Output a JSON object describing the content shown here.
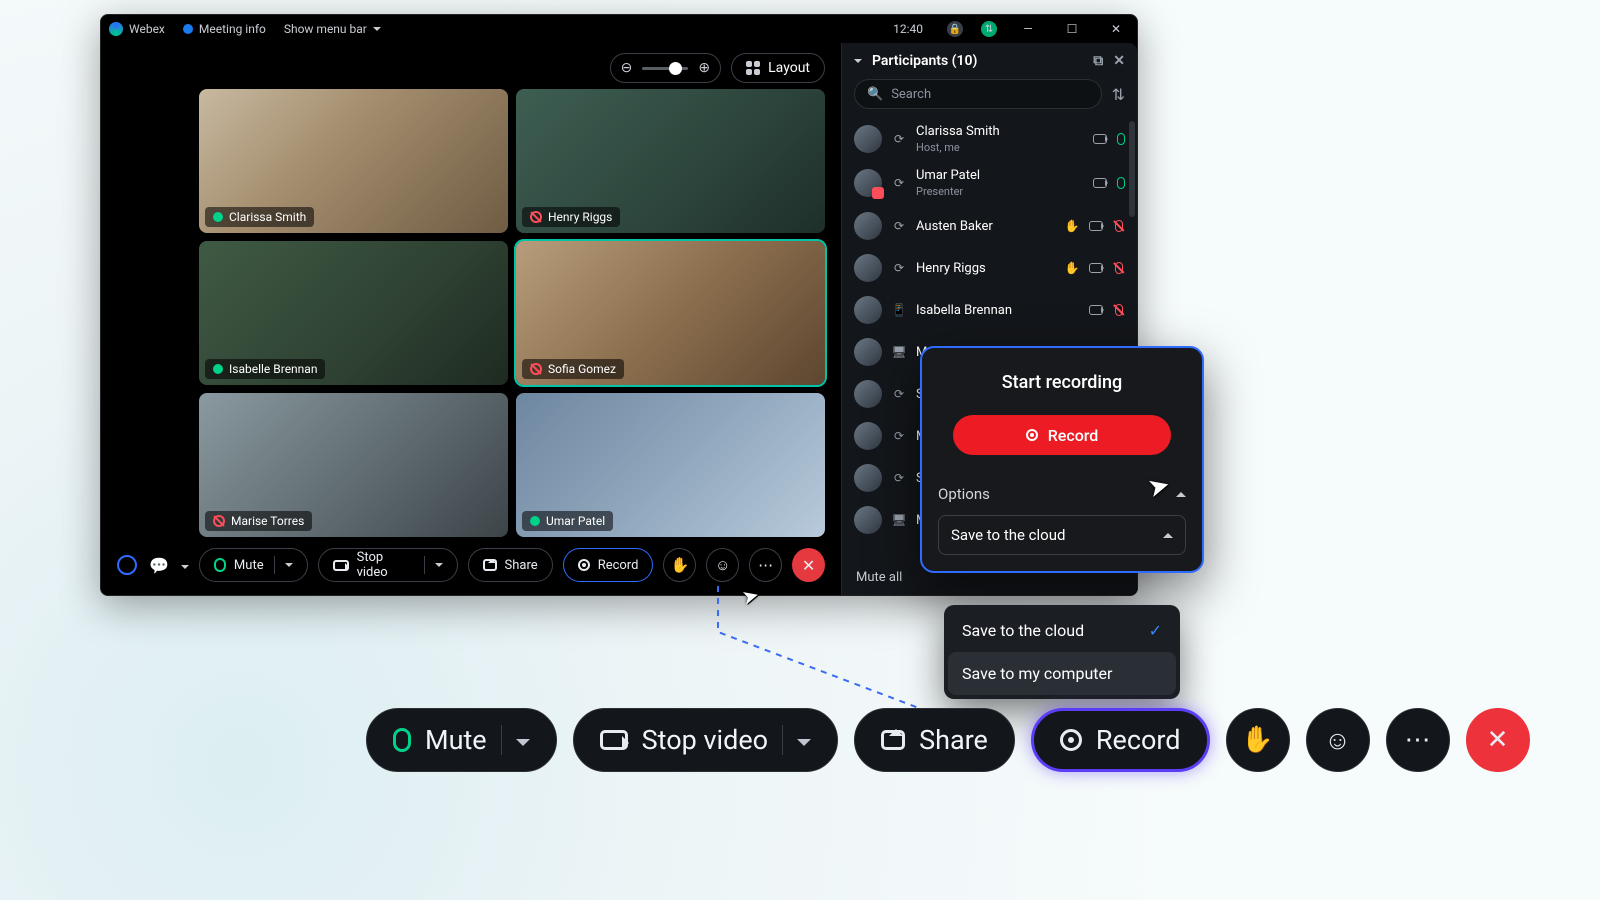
{
  "titlebar": {
    "app_name": "Webex",
    "meeting_info": "Meeting info",
    "menu_label": "Show menu bar",
    "clock": "12:40"
  },
  "stage": {
    "layout_button": "Layout",
    "tiles": [
      {
        "name": "Clarissa Smith",
        "muted": false
      },
      {
        "name": "Henry Riggs",
        "muted": true
      },
      {
        "name": "Isabelle Brennan",
        "muted": false
      },
      {
        "name": "Sofia Gomez",
        "muted": true,
        "active": true
      },
      {
        "name": "Marise Torres",
        "muted": true
      },
      {
        "name": "Umar Patel",
        "muted": false
      }
    ]
  },
  "toolbar": {
    "mute": "Mute",
    "stop_video": "Stop video",
    "share": "Share",
    "record": "Record"
  },
  "participants": {
    "heading": "Participants (10)",
    "search_placeholder": "Search",
    "mute_all": "Mute all",
    "list": [
      {
        "name": "Clarissa Smith",
        "sub": "Host, me",
        "cam": true,
        "mic": "on"
      },
      {
        "name": "Umar Patel",
        "sub": "Presenter",
        "cam": true,
        "mic": "on",
        "badge": true
      },
      {
        "name": "Austen Baker",
        "cam": true,
        "mic": "off",
        "hand": true
      },
      {
        "name": "Henry Riggs",
        "cam": true,
        "mic": "off",
        "hand": true
      },
      {
        "name": "Isabella Brennan",
        "cam": true,
        "mic": "off",
        "dev": "phone"
      },
      {
        "name": "Marise Torres",
        "cam": true,
        "mic": "off",
        "dev": "desktop"
      },
      {
        "name": "Sofia Gomez"
      },
      {
        "name": "Murphy Lin"
      },
      {
        "name": "Sonya Weiss"
      },
      {
        "name": "Marcus Hale"
      }
    ]
  },
  "popover": {
    "title": "Start recording",
    "record": "Record",
    "options": "Options",
    "save_selected": "Save to the cloud",
    "dd": {
      "cloud": "Save to the cloud",
      "computer": "Save to my computer"
    }
  },
  "bigbar": {
    "mute": "Mute",
    "stop_video": "Stop video",
    "share": "Share",
    "record": "Record"
  }
}
